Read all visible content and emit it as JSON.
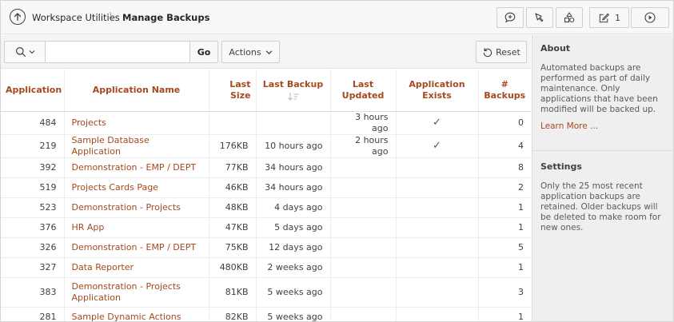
{
  "header": {
    "breadcrumb_parent": "Workspace Utilities",
    "breadcrumb_separator": "\\",
    "page_title": "Manage Backups",
    "edit_count": "1"
  },
  "toolbar": {
    "search_value": "",
    "go_label": "Go",
    "actions_label": "Actions",
    "reset_label": "Reset"
  },
  "table": {
    "columns": [
      "Application",
      "Application Name",
      "Last Size",
      "Last Backup",
      "Last Updated",
      "Application Exists",
      "# Backups"
    ],
    "rows": [
      {
        "app": "484",
        "name": "Projects",
        "size": "",
        "backup": "",
        "updated": "3 hours ago",
        "exists": "✓",
        "backups": "0"
      },
      {
        "app": "219",
        "name": "Sample Database Application",
        "size": "176KB",
        "backup": "10 hours ago",
        "updated": "2 hours ago",
        "exists": "✓",
        "backups": "4"
      },
      {
        "app": "392",
        "name": "Demonstration - EMP / DEPT",
        "size": "77KB",
        "backup": "34 hours ago",
        "updated": "",
        "exists": "",
        "backups": "8"
      },
      {
        "app": "519",
        "name": "Projects Cards Page",
        "size": "46KB",
        "backup": "34 hours ago",
        "updated": "",
        "exists": "",
        "backups": "2"
      },
      {
        "app": "523",
        "name": "Demonstration - Projects",
        "size": "48KB",
        "backup": "4 days ago",
        "updated": "",
        "exists": "",
        "backups": "1"
      },
      {
        "app": "376",
        "name": "HR App",
        "size": "47KB",
        "backup": "5 days ago",
        "updated": "",
        "exists": "",
        "backups": "1"
      },
      {
        "app": "326",
        "name": "Demonstration - EMP / DEPT",
        "size": "75KB",
        "backup": "12 days ago",
        "updated": "",
        "exists": "",
        "backups": "5"
      },
      {
        "app": "327",
        "name": "Data Reporter",
        "size": "480KB",
        "backup": "2 weeks ago",
        "updated": "",
        "exists": "",
        "backups": "1"
      },
      {
        "app": "383",
        "name": "Demonstration - Projects Application",
        "size": "81KB",
        "backup": "5 weeks ago",
        "updated": "",
        "exists": "",
        "backups": "3"
      },
      {
        "app": "281",
        "name": "Sample Dynamic Actions",
        "size": "82KB",
        "backup": "5 weeks ago",
        "updated": "",
        "exists": "",
        "backups": "1"
      }
    ]
  },
  "side": {
    "about_title": "About",
    "about_text": "Automated backups are performed as part of daily maintenance. Only applications that have been modified will be backed up.",
    "learn_more": "Learn More ...",
    "settings_title": "Settings",
    "settings_text": "Only the 25 most recent application backups are retained. Older backups will be deleted to make room for new ones."
  },
  "colors": {
    "accent": "#a5491f",
    "text": "#404040",
    "panel": "#efefef"
  }
}
